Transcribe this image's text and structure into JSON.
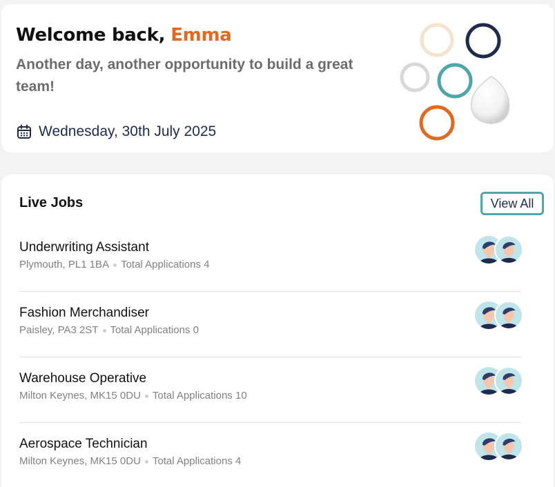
{
  "welcome": {
    "greeting": "Welcome back,",
    "name": "Emma",
    "subtitle": "Another day, another opportunity to build a great team!",
    "date": "Wednesday, 30th July 2025",
    "calendar_icon": "calendar-icon"
  },
  "colors": {
    "accent_orange": "#e06a1f",
    "accent_teal": "#4da6a8",
    "navy": "#1e2b4d",
    "decor_beige": "#f4e3cd",
    "decor_grey": "#d8d8d8"
  },
  "jobs": {
    "title": "Live Jobs",
    "view_all_label": "View All",
    "items": [
      {
        "title": "Underwriting Assistant",
        "location": "Plymouth, PL1 1BA",
        "applications": "Total Applications 4"
      },
      {
        "title": "Fashion Merchandiser",
        "location": "Paisley, PA3 2ST",
        "applications": "Total Applications 0"
      },
      {
        "title": "Warehouse Operative",
        "location": "Milton Keynes, MK15 0DU",
        "applications": "Total Applications 10"
      },
      {
        "title": "Aerospace Technician",
        "location": "Milton Keynes, MK15 0DU",
        "applications": "Total Applications 4"
      }
    ]
  }
}
